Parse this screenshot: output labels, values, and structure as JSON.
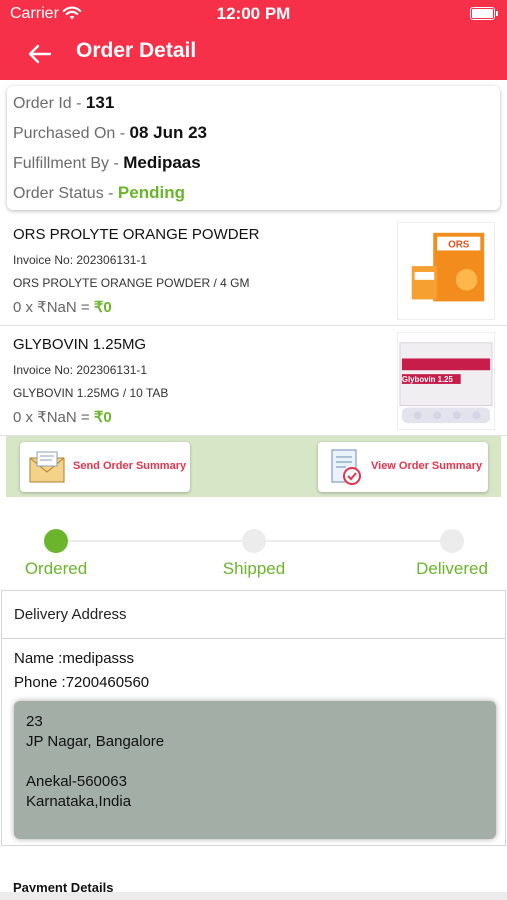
{
  "status_bar": {
    "carrier": "Carrier",
    "time": "12:00 PM"
  },
  "header": {
    "title": "Order Detail"
  },
  "order": {
    "id_label": "Order Id - ",
    "id_value": "131",
    "purchased_label": "Purchased On - ",
    "purchased_value": "08 Jun 23",
    "fulfillment_label": "Fulfillment By - ",
    "fulfillment_value": "Medipaas",
    "status_label": "Order Status - ",
    "status_value": "Pending"
  },
  "items": [
    {
      "name": "ORS PROLYTE ORANGE POWDER",
      "invoice": "Invoice No: 202306131-1",
      "desc": "ORS PROLYTE ORANGE POWDER / 4 GM",
      "qty_price": "0 x ₹NaN = ",
      "total": "₹0",
      "image_text": "ORS"
    },
    {
      "name": "GLYBOVIN 1.25MG",
      "invoice": "Invoice No: 202306131-1",
      "desc": "GLYBOVIN 1.25MG / 10 TAB",
      "qty_price": "0 x ₹NaN = ",
      "total": "₹0",
      "image_text": "Glybovin 1.25"
    }
  ],
  "actions": {
    "send_summary": "Send Order Summary",
    "view_summary": "View Order Summary"
  },
  "tracker": {
    "steps": [
      "Ordered",
      "Shipped",
      "Delivered"
    ],
    "active_step": 0
  },
  "delivery": {
    "heading": "Delivery Address",
    "name": "Name :medipasss",
    "phone": "Phone :7200460560",
    "address_lines": [
      "23",
      "JP Nagar, Bangalore",
      "",
      "Anekal-560063",
      "Karnataka,India"
    ]
  },
  "payment": {
    "heading": "Payment Details"
  },
  "colors": {
    "accent": "#f7304a",
    "success": "#6bb52c"
  }
}
